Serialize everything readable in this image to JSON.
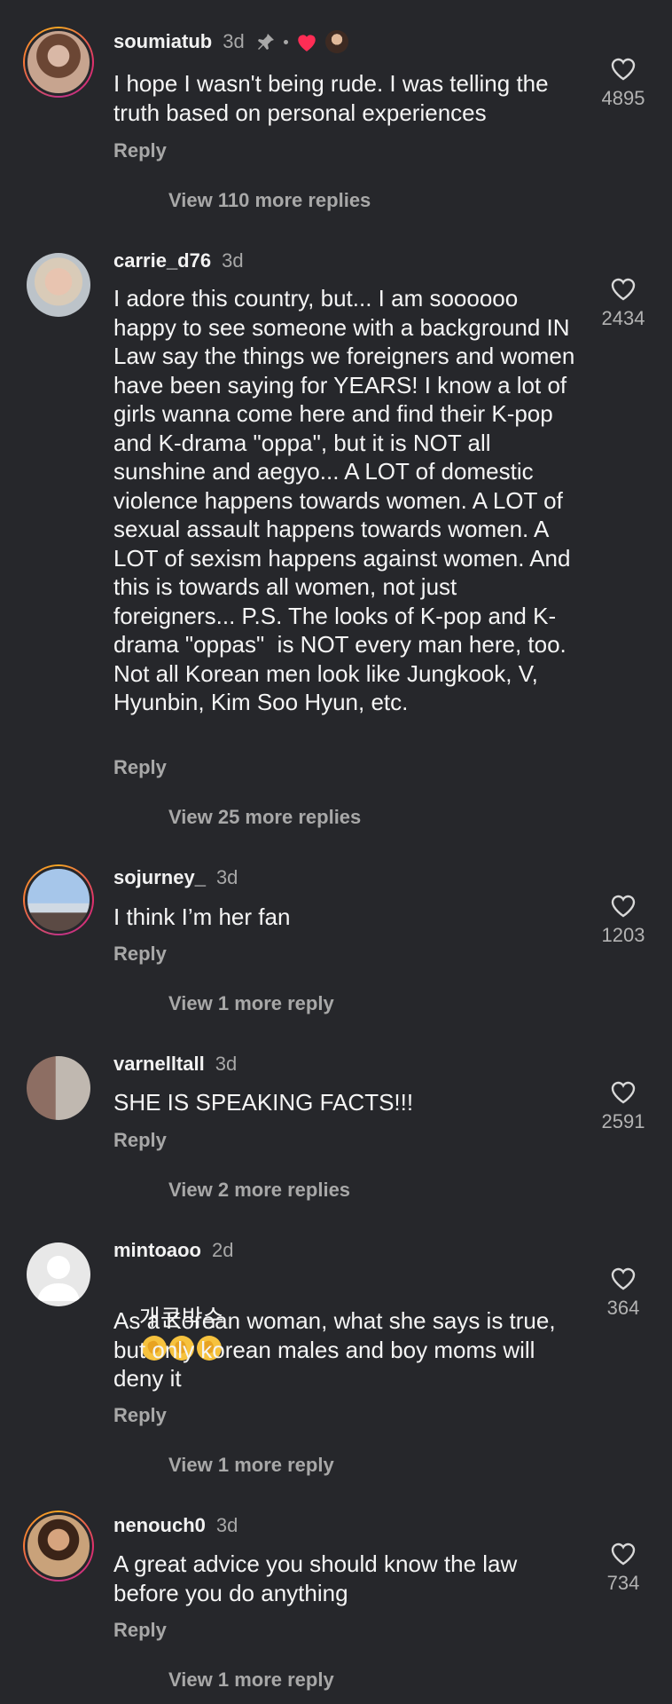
{
  "comments": [
    {
      "username": "soumiatub",
      "time": "3d",
      "text": "I hope I wasn't being rude. I was telling the truth based on personal experiences",
      "reply_label": "Reply",
      "view_more": "View 110 more replies",
      "likes": "4895",
      "avatar_icon": "avatar-woman-brunette"
    },
    {
      "username": "carrie_d76",
      "time": "3d",
      "text": "I adore this country, but... I am soooooo happy to see someone with a background IN Law say the things we foreigners and women have been saying for YEARS! I know a lot of girls wanna come here and find their K-pop and K-drama \"oppa\", but it is NOT all sunshine and aegyo... A LOT of domestic violence happens towards women. A LOT of sexual assault happens towards women. A LOT of sexism happens against women. And this is towards all women, not just foreigners... P.S. The looks of K-pop and K-drama \"oppas\"  is NOT every man here, too. Not all Korean men look like Jungkook, V, Hyunbin, Kim Soo Hyun, etc.",
      "reply_label": "Reply",
      "view_more": "View 25 more replies",
      "likes": "2434",
      "avatar_icon": "avatar-woman-blonde"
    },
    {
      "username": "sojurney_",
      "time": "3d",
      "text": "I think I’m her fan",
      "reply_label": "Reply",
      "view_more": "View 1 more reply",
      "likes": "1203",
      "avatar_icon": "avatar-tower-selfie"
    },
    {
      "username": "varnelltall",
      "time": "3d",
      "text": "SHE IS SPEAKING FACTS!!!",
      "reply_label": "Reply",
      "view_more": "View 2 more replies",
      "likes": "2591",
      "avatar_icon": "avatar-two-men"
    },
    {
      "username": "mintoaoo",
      "time": "2d",
      "korean_line": "개큰박수",
      "text": "As a Korean woman, what she says is true, but only korean males and boy moms will deny it",
      "reply_label": "Reply",
      "view_more": "View 1 more reply",
      "likes": "364",
      "avatar_icon": "avatar-default"
    },
    {
      "username": "nenouch0",
      "time": "3d",
      "text": "A great advice you should know the law before you do anything",
      "reply_label": "Reply",
      "view_more": "View 1 more reply",
      "likes": "734",
      "avatar_icon": "avatar-woman-dark"
    }
  ],
  "colors": {
    "background": "#26272b",
    "text": "#f5f5f5",
    "muted": "#a8a8a8",
    "heart_red": "#ff2d55"
  },
  "icons": {
    "pin": "pin-icon",
    "heart_like": "heart-outline-icon",
    "heart_badge": "heart-filled-icon",
    "clap": "clapping-hands-emoji"
  }
}
